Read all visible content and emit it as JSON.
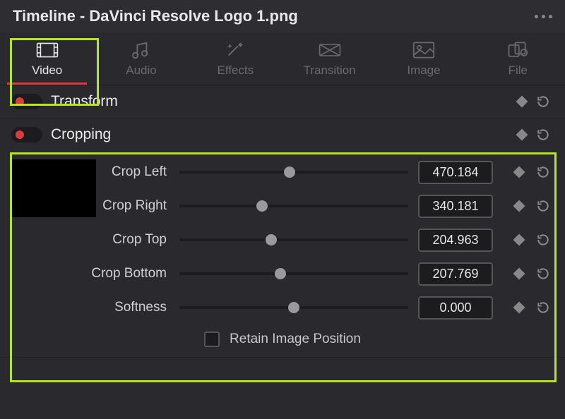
{
  "header": {
    "title": "Timeline - DaVinci Resolve Logo 1.png"
  },
  "tabs": [
    {
      "id": "video",
      "label": "Video",
      "active": true
    },
    {
      "id": "audio",
      "label": "Audio",
      "active": false
    },
    {
      "id": "effects",
      "label": "Effects",
      "active": false
    },
    {
      "id": "transition",
      "label": "Transition",
      "active": false
    },
    {
      "id": "image",
      "label": "Image",
      "active": false
    },
    {
      "id": "file",
      "label": "File",
      "active": false
    }
  ],
  "sections": {
    "transform": {
      "title": "Transform",
      "enabled": true
    },
    "cropping": {
      "title": "Cropping",
      "enabled": true,
      "params": [
        {
          "name": "crop_left",
          "label": "Crop Left",
          "value": "470.184",
          "thumb_pct": 48
        },
        {
          "name": "crop_right",
          "label": "Crop Right",
          "value": "340.181",
          "thumb_pct": 36
        },
        {
          "name": "crop_top",
          "label": "Crop Top",
          "value": "204.963",
          "thumb_pct": 40
        },
        {
          "name": "crop_bottom",
          "label": "Crop Bottom",
          "value": "207.769",
          "thumb_pct": 44
        },
        {
          "name": "softness",
          "label": "Softness",
          "value": "0.000",
          "thumb_pct": 50
        }
      ],
      "retain_label": "Retain Image Position",
      "retain_checked": false
    }
  }
}
